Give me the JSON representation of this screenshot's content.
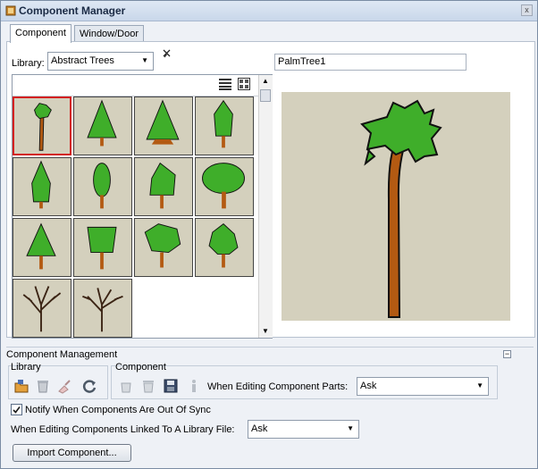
{
  "window": {
    "title": "Component Manager",
    "close_glyph": "x"
  },
  "tabs": [
    {
      "label": "Component",
      "active": true
    },
    {
      "label": "Window/Door",
      "active": false
    }
  ],
  "library": {
    "label": "Library:",
    "selected": "Abstract Trees"
  },
  "component_name": "PalmTree1",
  "grid_tool_icons": [
    "list-view-icon",
    "thumbnail-view-icon"
  ],
  "components": [
    "palm-tree",
    "conifer-tree",
    "fir-tree",
    "narrow-tree",
    "cypress-tree",
    "columnar-tree",
    "leaning-tree",
    "oak-tree",
    "cone-tree",
    "bushy-tree",
    "shrub-tree",
    "spiky-tree",
    "bare-tree",
    "bare-tree-2"
  ],
  "management": {
    "header": "Component Management",
    "collapse_glyph": "−",
    "library_group": "Library",
    "library_icons": [
      "open-library-icon",
      "delete-library-icon",
      "clean-library-icon",
      "refresh-icon"
    ],
    "component_group": "Component",
    "component_icons": [
      "add-component-icon",
      "remove-component-icon",
      "save-component-icon",
      "info-icon"
    ],
    "editing_parts_label": "When Editing Component Parts:",
    "editing_parts_value": "Ask",
    "notify_label": "Notify When Components Are Out Of Sync",
    "notify_checked": true,
    "linked_label": "When Editing Components Linked To A Library File:",
    "linked_value": "Ask",
    "import_button": "Import Component..."
  },
  "colors": {
    "foliage": "#3fae2a",
    "trunk": "#b35a12",
    "cell_bg": "#d4d0bd",
    "selection": "#d32020"
  }
}
